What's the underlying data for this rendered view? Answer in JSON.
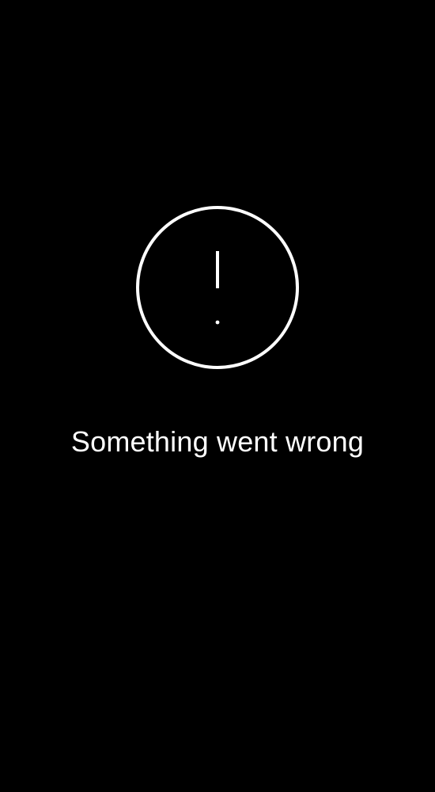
{
  "error": {
    "icon": "exclamation-circle-icon",
    "message": "Something went wrong"
  },
  "colors": {
    "background": "#000000",
    "foreground": "#ffffff"
  }
}
